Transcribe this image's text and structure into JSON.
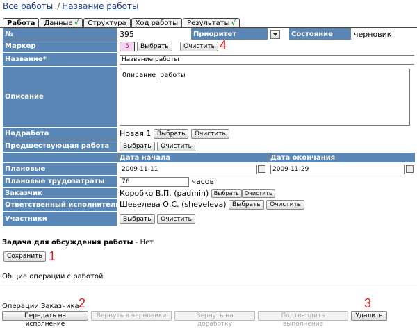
{
  "breadcrumb": {
    "all_works": "Все работы",
    "separator": "/",
    "current": "Название работы"
  },
  "tabs": [
    {
      "label": "Работа",
      "check": ""
    },
    {
      "label": "Данные",
      "check": "√"
    },
    {
      "label": "Структура",
      "check": ""
    },
    {
      "label": "Ход работы",
      "check": ""
    },
    {
      "label": "Результаты",
      "check": "√"
    }
  ],
  "form": {
    "number_label": "№",
    "number_value": "395",
    "priority_label": "Приоритет",
    "state_label": "Состояние",
    "state_value": "черновик",
    "marker_label": "Маркер",
    "marker_value": "5",
    "select_btn": "Выбрать",
    "clear_btn": "Очистить",
    "name_label": "Название*",
    "name_value": "Название работы",
    "description_label": "Описание",
    "description_value": "Описание работы",
    "parent_label": "Надработа",
    "parent_value": "Новая 1",
    "predecessor_label": "Предшествующая работа",
    "start_header": "Дата начала",
    "end_header": "Дата окончания",
    "planned_label": "Плановые",
    "start_value": "2009-11-11",
    "end_value": "2009-11-29",
    "effort_label": "Плановые трудозатраты",
    "effort_value": "76",
    "effort_unit": "часов",
    "customer_label": "Заказчик",
    "customer_value": "Коробко В.П. (padmin)",
    "executor_label": "Ответственный исполнитель",
    "executor_value": "Шевелева О.С. (sheveleva)",
    "participants_label": "Участники"
  },
  "discussion": {
    "label": "Задача для обсуждения работы",
    "value": "- Нет"
  },
  "save_btn": "Сохранить",
  "general_ops": "Общие операции с работой",
  "customer_ops": "Операции Заказчика",
  "ops": {
    "send": "Передать на исполнение",
    "return_draft": "Вернуть в черновики",
    "return_rework": "Вернуть на доработку",
    "confirm": "Подтвердить выполнение",
    "delete": "Удалить"
  },
  "annotations": {
    "a1": "1",
    "a2": "2",
    "a3": "3",
    "a4": "4"
  },
  "colors": {
    "label_bg": "#5b87b7",
    "annotation": "#e02020",
    "marker_bg": "#f7d3f2"
  }
}
